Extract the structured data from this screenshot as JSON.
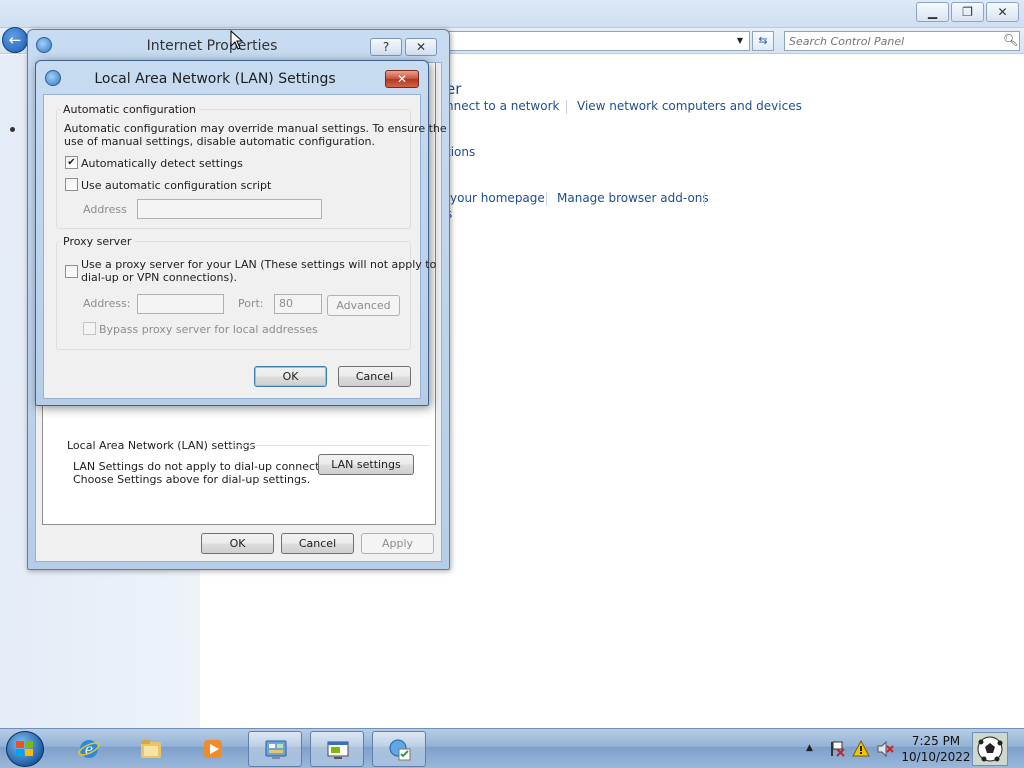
{
  "control_panel": {
    "search": {
      "placeholder": "Search Control Panel"
    },
    "heading_fragment": "er",
    "links": {
      "connect_network": "nnect to a network",
      "view_network_computers": "View network computers and devices",
      "options_fragment": "tions",
      "homepage": "your homepage",
      "manage_addons": "Manage browser add-ons",
      "s_fragment": "s"
    }
  },
  "internet_properties": {
    "title": "Internet Properties",
    "help_label": "?",
    "close_label": "✕",
    "lan_group": {
      "title": "Local Area Network (LAN) settings",
      "desc_line_1": "LAN Settings do not apply to dial-up connections.",
      "desc_line_2": "Choose Settings above for dial-up settings.",
      "button": "LAN settings"
    },
    "buttons": {
      "ok": "OK",
      "cancel": "Cancel",
      "apply": "Apply"
    }
  },
  "lan_settings": {
    "title": "Local Area Network (LAN) Settings",
    "close_label": "✕",
    "auto_config": {
      "title": "Automatic configuration",
      "desc_line_1": "Automatic configuration may override manual settings.  To ensure the",
      "desc_line_2": "use of manual settings, disable automatic configuration.",
      "detect_label": "Automatically detect settings",
      "detect_checked": true,
      "script_label": "Use automatic configuration script",
      "script_checked": false,
      "address_label": "Address",
      "address_value": ""
    },
    "proxy": {
      "title": "Proxy server",
      "use_proxy_line_1": "Use a proxy server for your LAN (These settings will not apply to",
      "use_proxy_line_2": "dial-up or VPN connections).",
      "use_proxy_checked": false,
      "address_label": "Address:",
      "address_value": "",
      "port_label": "Port:",
      "port_value": "80",
      "advanced_button": "Advanced",
      "bypass_label": "Bypass proxy server for local addresses",
      "bypass_checked": false
    },
    "buttons": {
      "ok": "OK",
      "cancel": "Cancel"
    }
  },
  "taskbar": {
    "clock_time": "7:25 PM",
    "clock_date": "10/10/2022",
    "tray_arrow": "▲"
  },
  "window_controls": {
    "minimize": "▁",
    "maximize": "❐",
    "close": "✕"
  },
  "colors": {
    "link": "#1e4e94",
    "titlebar": "#c7dbf1",
    "close_red": "#c75038"
  }
}
